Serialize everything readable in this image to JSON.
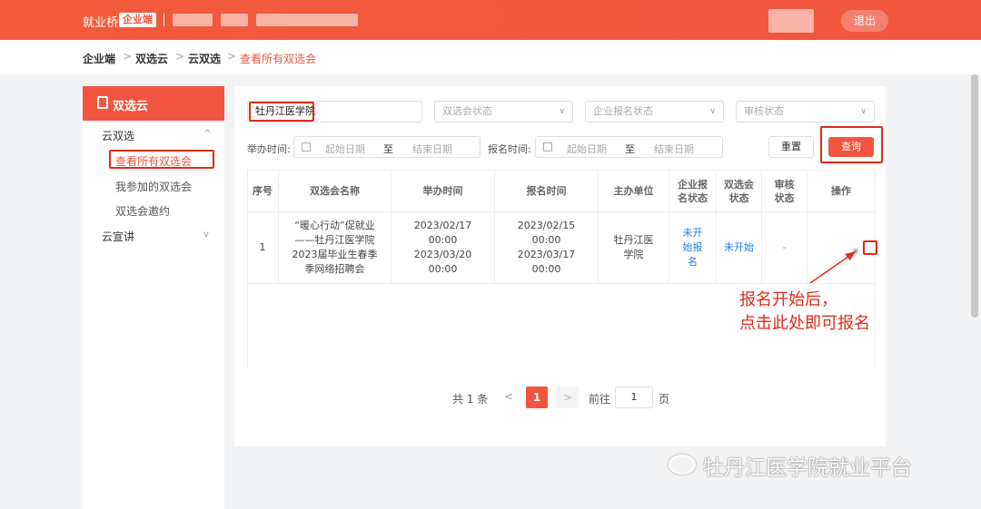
{
  "header": {
    "brand": "就业桥",
    "badge": "企业端",
    "logout": "退出"
  },
  "breadcrumb": [
    "企业端",
    "双选云",
    "云双选",
    "查看所有双选会"
  ],
  "sidebar": {
    "title": "双选云",
    "groups": [
      {
        "label": "云双选",
        "caret": "^",
        "items": [
          "查看所有双选会",
          "我参加的双选会",
          "双选会邀约"
        ]
      },
      {
        "label": "云宣讲",
        "caret": "v"
      }
    ]
  },
  "filters": {
    "keyword": "牡丹江医学院",
    "status_placeholder": "双选会状态",
    "signup_placeholder": "企业报名状态",
    "review_placeholder": "审核状态",
    "hold_label": "举办时间:",
    "signup_label": "报名时间:",
    "start_date": "起始日期",
    "to": "至",
    "end_date": "结束日期",
    "reset": "重置",
    "query": "查询"
  },
  "table": {
    "columns": [
      "序号",
      "双选会名称",
      "举办时间",
      "报名时间",
      "主办单位",
      "企业报名状态",
      "双选会状态",
      "审核状态",
      "操作"
    ],
    "rows": [
      {
        "index": "1",
        "name": "“暖心行动”促就业——牡丹江医学院2023届毕业生春季季网络招聘会",
        "hold_time": "2023/02/17 00:00 2023/03/20 00:00",
        "signup_time": "2023/02/15 00:00 2023/03/17 00:00",
        "organizer": "牡丹江医学院",
        "signup_status": "未开始报名",
        "fair_status": "未开始",
        "review_status": "-"
      }
    ]
  },
  "pagination": {
    "total": "共 1 条",
    "prev": "<",
    "current": "1",
    "next": ">",
    "goto": "前往",
    "page_value": "1",
    "page_unit": "页"
  },
  "annotation": {
    "line1": "报名开始后，",
    "line2": "点击此处即可报名"
  },
  "watermark": "牡丹江医学院就业平台",
  "colors": {
    "accent": "#f2553f",
    "highlight": "#e02a1c",
    "link": "#1e7ee8"
  }
}
